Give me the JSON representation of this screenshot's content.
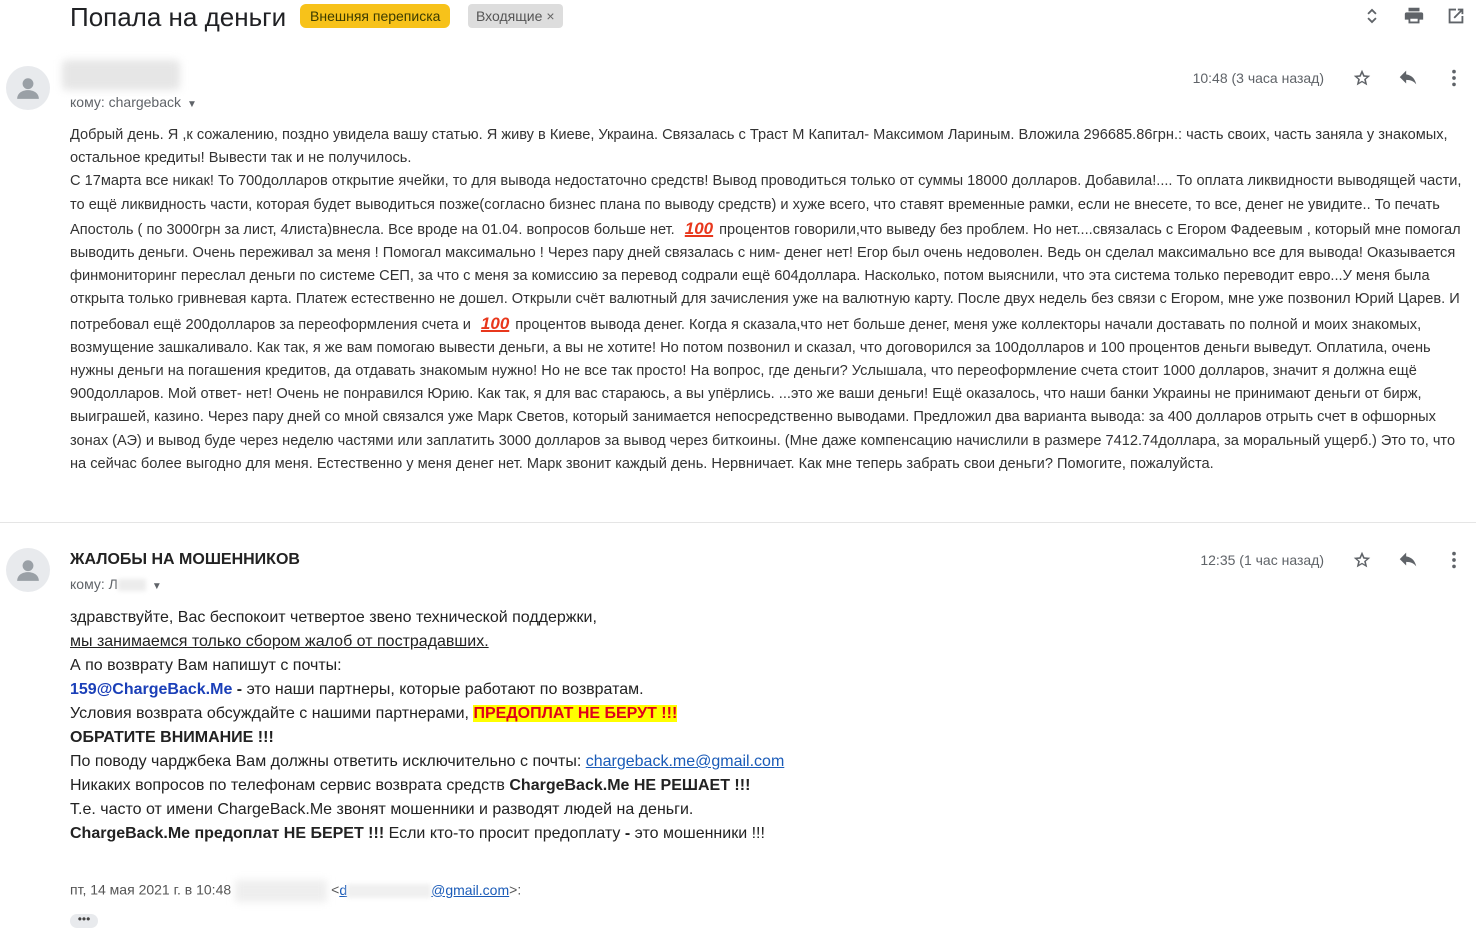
{
  "header": {
    "subject": "Попала на деньги",
    "label_external": "Внешняя переписка",
    "label_inbox": "Входящие",
    "label_inbox_close": "×"
  },
  "message1": {
    "to": "кому: chargeback",
    "time": "10:48 (3 часа назад)",
    "paragraphs": [
      "Добрый день. Я ,к сожалению, поздно увидела вашу статью. Я живу в Киеве, Украина. Связалась с Траст М Капитал- Максимом Лариным. Вложила 296685.86грн.: часть своих, часть заняла у знакомых, остальное кредиты! Вывести так и не получилось."
    ],
    "p2_a": " С 17марта все никак! То 700долларов открытие ячейки, то для вывода недостаточно средств! Вывод проводиться только от суммы 18000 долларов. Добавила!.... То оплата ликвидности выводящей части, то ещё ликвидность части, которая будет выводиться позже(согласно бизнес плана по выводу средств) и хуже всего, что ставят временные рамки, если не внесете, то все, денег не увидите.. То печать Апостоль ( по 3000грн за лист, 4листа)внесла. Все вроде на 01.04. вопросов больше нет.",
    "emoji": "100",
    "p2_b": "процентов говорили,что выведу без проблем. Но нет....связалась с Егором Фадеевым , который мне помогал выводить деньги. Очень переживал за меня ! Помогал максимально ! Через пару дней связалась с ним- денег нет! Егор был очень недоволен. Ведь он сделал максимально все для вывода! Оказывается финмониторинг переслал деньги по системе СЕП, за что с меня за комиссию за перевод содрали ещё 604доллара. Насколько, потом выяснили, что эта система только переводит евро...У меня была открыта только гривневая карта. Платеж естественно не дошел. Открыли счёт валютный для зачисления уже на валютную карту.  После двух недель без связи с Егором, мне уже позвонил Юрий Царев. И потребовал ещё 200долларов за переоформления счета и",
    "p2_c": "процентов вывода денег. Когда я сказала,что нет больше денег, меня уже коллекторы начали доставать по полной и моих знакомых, возмущение зашкаливало. Как так, я же вам помогаю вывести деньги, а вы не хотите! Но потом позвонил и сказал, что договорился за 100долларов и 100 процентов деньги выведут. Оплатила, очень нужны деньги на погашения кредитов, да отдавать знакомым нужно! Но не все так просто! На вопрос, где деньги? Услышала, что переоформление счета стоит 1000 долларов, значит я должна ещё 900долларов. Мой ответ- нет! Очень не понравился Юрию. Как так, я для вас стараюсь, а вы упёрлись. ...это же ваши деньги! Ещё оказалось, что наши банки Украины не принимают деньги от бирж, выиграшей, казино. Через пару дней со мной связался уже Марк Светов, который занимается непосредственно выводами. Предложил два варианта вывода: за 400 долларов  отрыть счет в офшорных зонах (АЭ) и вывод буде через неделю частями или заплатить 3000 долларов за вывод через биткоины. (Мне даже компенсацию начислили в размере 7412.74доллара, за моральный ущерб.) Это то, что на сейчас более выгодно для меня. Естественно у меня денег нет. Марк звонит каждый день. Нервничает. Как мне теперь забрать свои деньги? Помогите, пожалуйста."
  },
  "message2": {
    "sender": "ЖАЛОБЫ НА МОШЕННИКОВ",
    "to_prefix": "кому: Л",
    "time": "12:35 (1 час назад)",
    "l1": "здравствуйте, Вас беспокоит четвертое звено технической поддержки,",
    "l2": "мы занимаемся только сбором жалоб от пострадавших.",
    "l3": "А по возврату Вам напишут с почты:",
    "l4_email": "159@ChargeBack.Me",
    "l4_dash": " - ",
    "l4_rest": "это наши партнеры, которые работают по возвратам.",
    "l5_text": "Условия возврата обсуждайте с нашими партнерами, ",
    "l5_highlight": "ПРЕДОПЛАТ НЕ БЕРУТ !!!",
    "l6": "ОБРАТИТЕ ВНИМАНИЕ !!!",
    "l7_text": "По поводу чарджбека Вам должны ответить исключительно с почты: ",
    "l7_link": "chargeback.me@gmail.com",
    "l8_text": "Никаких вопросов по телефонам сервис возврата средств ",
    "l8_bold": "ChargeBack.Me НЕ РЕШАЕТ !!!",
    "l9": "Т.е. часто от имени ChargeBack.Me звонят мошенники и разводят людей на деньги.",
    "l10_bold": "ChargeBack.Me предоплат НЕ БЕРЕТ !!!",
    "l10_text": " Если кто-то просит предоплату ",
    "l10_dash": "-",
    "l10_rest": " это мошенники !!!",
    "quote_date": "пт, 14 мая 2021 г. в 10:48",
    "quote_email_prefix": "d",
    "quote_email_suffix": "@gmail.com",
    "quote_lt": "<",
    "quote_gt": ">:",
    "dots": "•••"
  }
}
